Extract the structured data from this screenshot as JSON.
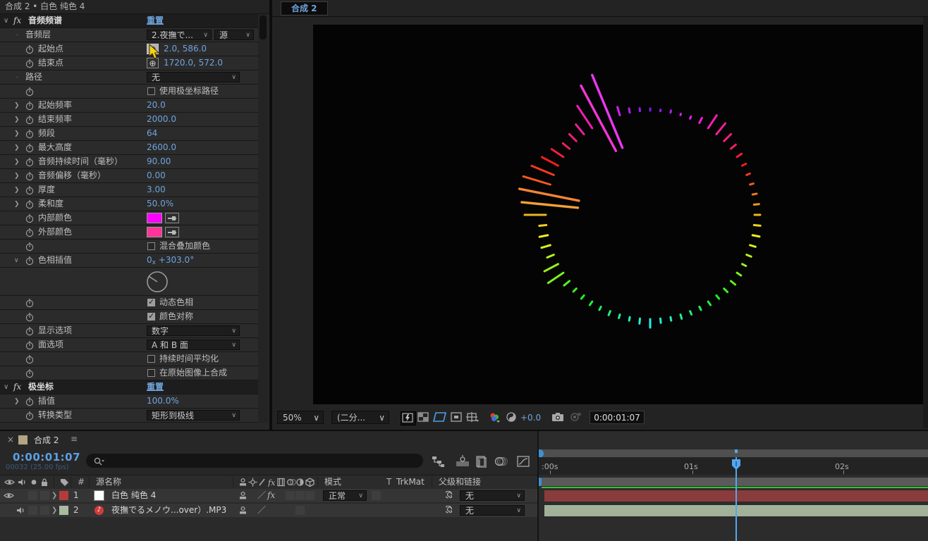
{
  "effect_panel": {
    "header": "合成 2 • 白色 纯色 4",
    "value_color": "#6fa3dc",
    "rows": [
      {
        "type": "fxheader",
        "label": "音频频谱",
        "reset": "重置"
      },
      {
        "type": "dropdown2",
        "label": "音频层",
        "value1": "2.夜撫で...",
        "value2": "源"
      },
      {
        "type": "point",
        "label": "起始点",
        "value": "2.0, 586.0",
        "active": true
      },
      {
        "type": "point",
        "label": "结束点",
        "value": "1720.0, 572.0"
      },
      {
        "type": "dropdown",
        "label": "路径",
        "value": "无",
        "stopwatch": false
      },
      {
        "type": "checkbox",
        "label": "使用极坐标路径",
        "checked": false
      },
      {
        "type": "value",
        "label": "起始频率",
        "value": "20.0"
      },
      {
        "type": "value",
        "label": "结束频率",
        "value": "2000.0"
      },
      {
        "type": "value",
        "label": "频段",
        "value": "64"
      },
      {
        "type": "value",
        "label": "最大高度",
        "value": "2600.0"
      },
      {
        "type": "value",
        "label": "音频持续时间（毫秒）",
        "value": "90.00"
      },
      {
        "type": "value",
        "label": "音频偏移（毫秒）",
        "value": "0.00"
      },
      {
        "type": "value",
        "label": "厚度",
        "value": "3.00"
      },
      {
        "type": "value",
        "label": "柔和度",
        "value": "50.0%"
      },
      {
        "type": "color",
        "label": "内部颜色",
        "color": "#ff00ff"
      },
      {
        "type": "color",
        "label": "外部颜色",
        "color": "#ff3399"
      },
      {
        "type": "checkbox",
        "label": "混合叠加颜色",
        "checked": false
      },
      {
        "type": "hue",
        "label": "色相插值",
        "rev": "0",
        "sub": "x",
        "deg": "+303.0°"
      },
      {
        "type": "dial",
        "angle": 303
      },
      {
        "type": "checkbox",
        "label": "动态色相",
        "checked": true
      },
      {
        "type": "checkbox",
        "label": "颜色对称",
        "checked": true
      },
      {
        "type": "dropdown",
        "label": "显示选项",
        "value": "数字",
        "stopwatch": true
      },
      {
        "type": "dropdown",
        "label": "面选项",
        "value": "A 和 B 面",
        "stopwatch": true
      },
      {
        "type": "checkbox",
        "label": "持续时间平均化",
        "checked": false
      },
      {
        "type": "checkbox",
        "label": "在原始图像上合成",
        "checked": false
      },
      {
        "type": "fxheader",
        "label": "极坐标",
        "reset": "重置"
      },
      {
        "type": "value",
        "label": "插值",
        "value": "100.0%"
      },
      {
        "type": "dropdown",
        "label": "转换类型",
        "value": "矩形到极线",
        "stopwatch": true
      }
    ]
  },
  "viewer": {
    "tab": "合成 2",
    "zoom": "50%",
    "resolution": "(二分...",
    "exposure": "+0.0",
    "timecode": "0:00:01:07"
  },
  "spectrum": {
    "inner_color": "#ff00ff",
    "outer_color": "#ff3399",
    "bands": 64,
    "hue_start": 265,
    "hue_span": 275,
    "lengths": [
      3,
      2,
      3,
      2,
      3,
      8,
      22,
      20,
      14,
      9,
      8,
      6,
      5,
      5,
      6,
      7,
      8,
      9,
      10,
      8,
      7,
      6,
      7,
      8,
      7,
      6,
      6,
      5,
      5,
      6,
      5,
      6,
      12,
      7,
      5,
      5,
      6,
      5,
      6,
      6,
      6,
      10,
      26,
      22,
      10,
      13,
      12,
      10,
      30,
      80,
      86,
      40,
      34,
      26,
      20,
      12,
      14,
      18,
      38,
      105,
      112,
      12,
      6,
      4
    ]
  },
  "timeline": {
    "tab": {
      "close": "×",
      "label": "合成 2",
      "menu": "≡"
    },
    "timecode": "0:00:01:07",
    "timecode_sub": "00032 (25.00 fps)",
    "columns": {
      "source": "源名称",
      "mode": "模式",
      "t": "T",
      "trkmat": "TrkMat",
      "parent": "父级和链接",
      "hash": "#"
    },
    "ruler_labels": [
      ":00s",
      "01s",
      "02s"
    ],
    "layers": [
      {
        "num": "1",
        "name": "白色 纯色 4",
        "label_color": "#b53b3b",
        "bar_color": "#8a3b3b",
        "mode": "正常",
        "parent": "无",
        "kind": "solid"
      },
      {
        "num": "2",
        "name": "夜撫でるメノウ...over）.MP3",
        "label_color": "#a9bba0",
        "bar_color": "#a2b299",
        "parent": "无",
        "kind": "audio"
      }
    ]
  }
}
